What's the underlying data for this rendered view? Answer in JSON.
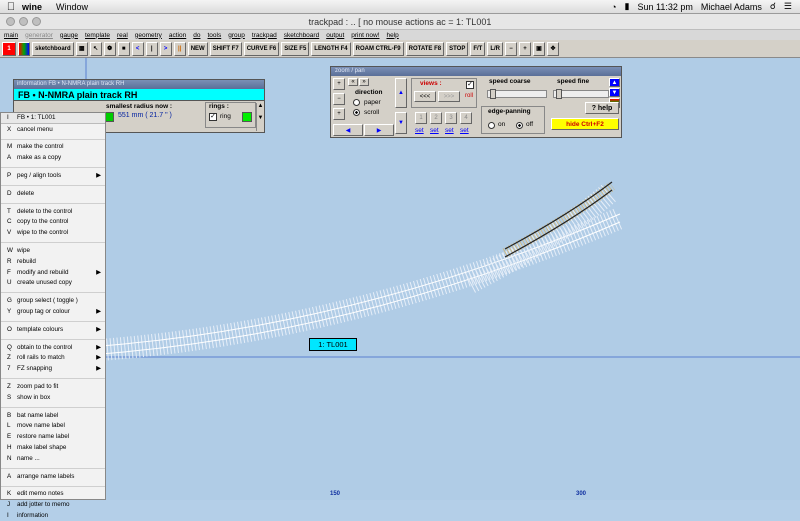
{
  "mac_menubar": {
    "app": "wine",
    "window_menu": "Window",
    "clock": "Sun 11:32 pm",
    "user": "Michael Adams"
  },
  "window_title": "trackpad  :  ..   [  no  mouse  actions  ac =   1: TL001",
  "menus": [
    "main",
    "generator",
    "gauge",
    "template",
    "real",
    "geometry",
    "action",
    "do",
    "tools",
    "group",
    "trackpad",
    "sketchboard",
    "output",
    "print now!",
    "help"
  ],
  "toolbar": {
    "number": "1",
    "sketchboard": "sketchboard",
    "buttons": [
      "NEW",
      "SHIFT F7",
      "CURVE F6",
      "SIZE F5",
      "LENGTH F4",
      "ROAM CTRL-F9",
      "ROTATE F8",
      "STOP",
      "F/T",
      "L/R"
    ]
  },
  "info_window": {
    "title": "information  FB • N-NMRA  plain track  RH",
    "banner": "FB • N-NMRA  plain track   RH",
    "radius_label": "smallest radius now :",
    "radius_value": "551 mm  ( 21.7 \" )",
    "rings_label": "rings :",
    "ring_label": "ring"
  },
  "zoom_window": {
    "title": "zoom / pan",
    "direction_label": "direction",
    "paper_label": "paper",
    "scroll_label": "scroll",
    "views_label": "views :",
    "back_label": "<<<",
    "fwd_label": ">>>",
    "roll_label": "roll",
    "nums": [
      "1",
      "2",
      "3",
      "4"
    ],
    "set_label": "set",
    "speed_coarse": "speed coarse",
    "speed_fine": "speed fine",
    "help_label": "? help",
    "edge_label": "edge-panning",
    "on_label": "on",
    "off_label": "off",
    "hide_label": "hide  Ctrl+F2"
  },
  "template_label": "1: TL001",
  "ruler": {
    "x150": "150",
    "x300": "300"
  },
  "context_menu": [
    {
      "key": "I",
      "label": "FB •  1: TL001",
      "top": true
    },
    {
      "key": "X",
      "label": "cancel menu"
    },
    {
      "sep": true
    },
    {
      "key": "M",
      "label": "make the control"
    },
    {
      "key": "A",
      "label": "make as a copy"
    },
    {
      "sep": true
    },
    {
      "key": "P",
      "label": "peg / align tools",
      "sub": true
    },
    {
      "sep": true
    },
    {
      "key": "D",
      "label": "delete"
    },
    {
      "sep": true
    },
    {
      "key": "T",
      "label": "delete to the control"
    },
    {
      "key": "C",
      "label": "copy to the control"
    },
    {
      "key": "V",
      "label": "wipe to the control"
    },
    {
      "sep": true
    },
    {
      "key": "W",
      "label": "wipe"
    },
    {
      "key": "R",
      "label": "rebuild"
    },
    {
      "key": "F",
      "label": "modify and rebuild",
      "sub": true
    },
    {
      "key": "U",
      "label": "create unused copy"
    },
    {
      "sep": true
    },
    {
      "key": "G",
      "label": "group select  ( toggle )"
    },
    {
      "key": "Y",
      "label": "group tag or colour",
      "sub": true
    },
    {
      "sep": true
    },
    {
      "key": "O",
      "label": "template colours",
      "sub": true
    },
    {
      "sep": true
    },
    {
      "key": "Q",
      "label": "obtain to the control",
      "sub": true
    },
    {
      "key": "Z",
      "label": "roll rails to match",
      "sub": true
    },
    {
      "key": "7",
      "label": "FZ  snapping",
      "sub": true
    },
    {
      "sep": true
    },
    {
      "key": "Z",
      "label": "zoom pad to fit"
    },
    {
      "key": "S",
      "label": "show in box"
    },
    {
      "sep": true
    },
    {
      "key": "B",
      "label": "bat name label"
    },
    {
      "key": "L",
      "label": "move name label"
    },
    {
      "key": "E",
      "label": "restore name label"
    },
    {
      "key": "H",
      "label": "make label shape"
    },
    {
      "key": "N",
      "label": "name ..."
    },
    {
      "sep": true
    },
    {
      "key": "A",
      "label": "arrange name labels"
    },
    {
      "sep": true
    },
    {
      "key": "K",
      "label": "edit memo notes"
    },
    {
      "key": "J",
      "label": "add jotter to memo"
    },
    {
      "key": "I",
      "label": "information"
    }
  ]
}
